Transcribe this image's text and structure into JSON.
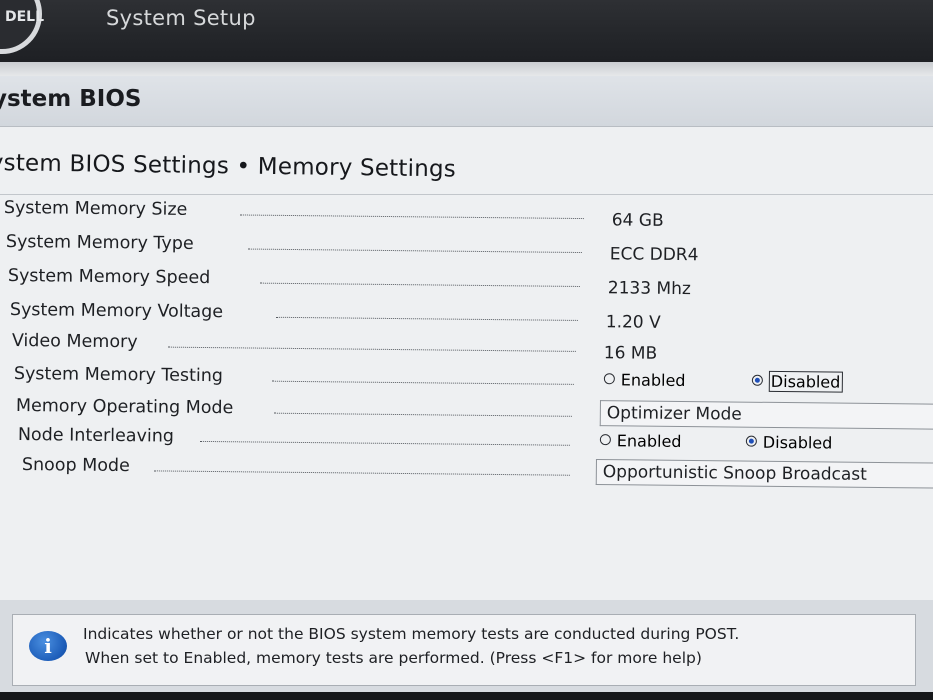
{
  "header": {
    "logo_text": "DELL",
    "app_title": "System Setup"
  },
  "section": {
    "title": "ystem BIOS"
  },
  "page": {
    "title": "ystem BIOS Settings • Memory Settings"
  },
  "settings": {
    "memory_size": {
      "label": "System Memory Size",
      "value": "64 GB"
    },
    "memory_type": {
      "label": "System Memory Type",
      "value": "ECC DDR4"
    },
    "memory_speed": {
      "label": "System Memory Speed",
      "value": "2133 Mhz"
    },
    "memory_voltage": {
      "label": "System Memory Voltage",
      "value": "1.20 V"
    },
    "video_memory": {
      "label": "Video Memory",
      "value": "16 MB"
    },
    "memory_testing": {
      "label": "System Memory Testing",
      "option_enabled": "Enabled",
      "option_disabled": "Disabled",
      "selected": "Disabled"
    },
    "operating_mode": {
      "label": "Memory Operating Mode",
      "value": "Optimizer Mode"
    },
    "node_interleaving": {
      "label": "Node Interleaving",
      "option_enabled": "Enabled",
      "option_disabled": "Disabled",
      "selected": "Disabled"
    },
    "snoop_mode": {
      "label": "Snoop Mode",
      "value": "Opportunistic Snoop Broadcast"
    }
  },
  "help": {
    "line1": "Indicates whether or not the BIOS system memory tests are conducted during POST.",
    "line2": "When set to Enabled, memory tests are performed. (Press <F1> for more help)"
  },
  "colors": {
    "header_bg": "#2a2c30",
    "panel_bg": "#eef0f2",
    "radio_selected": "#1f4fb8",
    "info_icon": "#1c5cb8"
  }
}
